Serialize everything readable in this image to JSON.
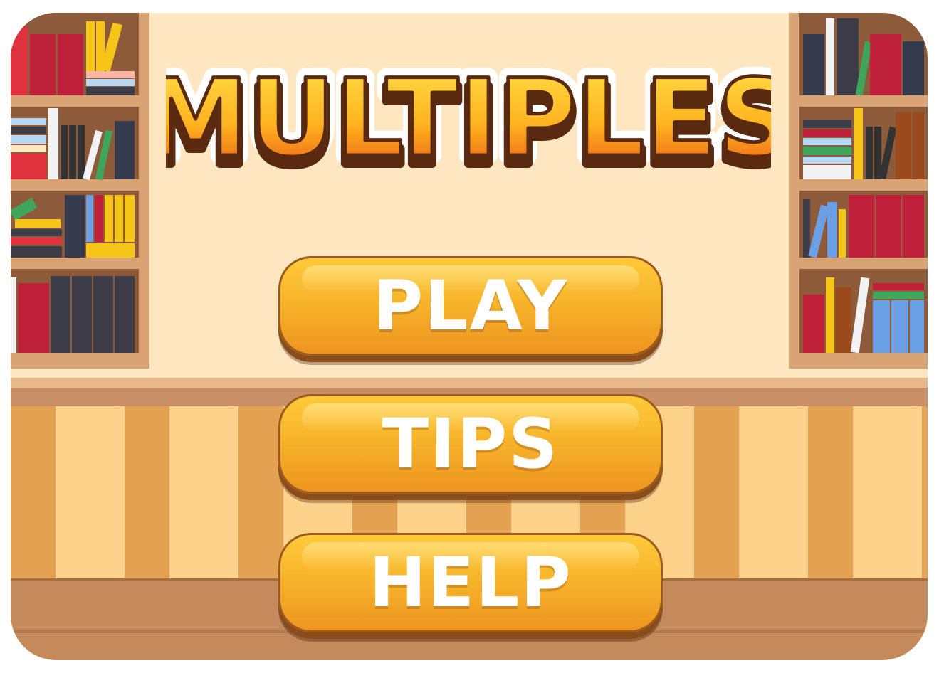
{
  "game": {
    "title": "MULTIPLES",
    "menu": {
      "play_label": "PLAY",
      "tips_label": "TIPS",
      "help_label": "HELP"
    }
  },
  "colors": {
    "wall": "#fde6c0",
    "button": "#f7b52b",
    "button_text": "#ffffff",
    "title_fill": "#ffb21e",
    "title_outline": "#5a2a10",
    "floor": "#c48a5c"
  }
}
